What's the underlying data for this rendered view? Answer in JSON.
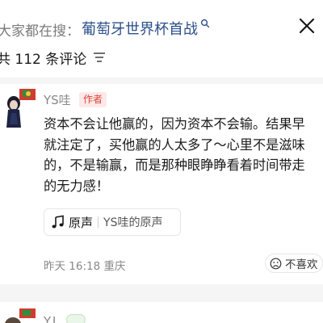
{
  "search": {
    "prefix": "大家都在搜：",
    "term": "葡萄牙世界杯首战"
  },
  "comments_header": {
    "count_text": "共 112 条评论"
  },
  "comment": {
    "username": "YS哇",
    "badge": "作者",
    "lines": [
      "资本不会让他赢的，因为资本不会输。结果早",
      "就注定了，买他赢的人太多了～心里不是滋味",
      "的，不是输赢，而是那种眼睁睁看着时间带走",
      "的无力感！"
    ],
    "voice": {
      "title": "原声",
      "name": "YS哇的原声"
    },
    "time": "昨天 16:18",
    "location": "重庆",
    "dislike_label": "不喜欢"
  },
  "next_comment": {
    "username": "Y.L"
  },
  "colors": {
    "link_blue": "#2c4f8a",
    "author_red": "#d9463d",
    "author_bg": "#fde9e7",
    "muted": "#888888",
    "separator": "#f5f5f5"
  }
}
